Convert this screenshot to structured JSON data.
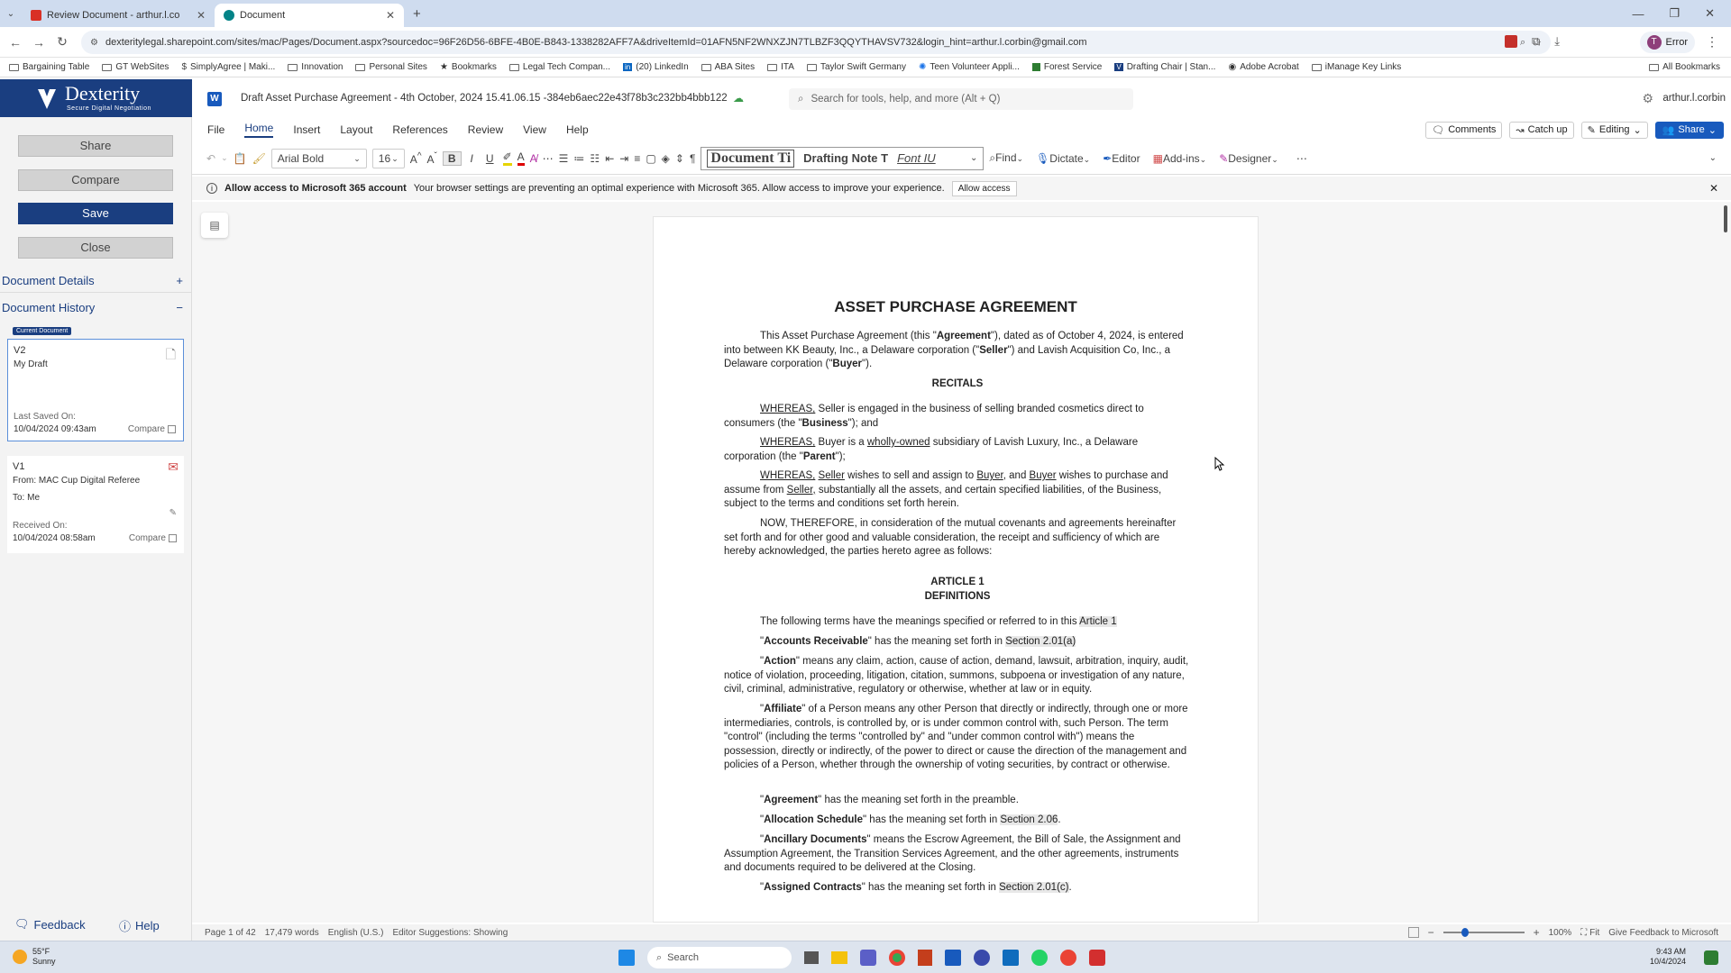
{
  "browser": {
    "tabs": [
      {
        "title": "Review Document - arthur.l.co"
      },
      {
        "title": "Document"
      }
    ],
    "new_tab": "+",
    "url": "dexteritylegal.sharepoint.com/sites/mac/Pages/Document.aspx?sourcedoc=96F26D56-6BFE-4B0E-B843-1338282AFF7A&driveItemId=01AFN5NF2WNXZJN7TLBZF3QQYTHAVSV732&login_hint=arthur.l.corbin@gmail.com",
    "profile_label": "Error",
    "profile_initial": "T",
    "bookmarks": [
      "Bargaining Table",
      "GT WebSites",
      "SimplyAgree | Maki...",
      "Innovation",
      "Personal Sites",
      "Bookmarks",
      "Legal Tech Compan...",
      "(20) LinkedIn",
      "ABA Sites",
      "ITA",
      "Taylor Swift Germany",
      "Teen Volunteer Appli...",
      "Forest Service",
      "Drafting Chair | Stan...",
      "Adobe Acrobat",
      "iManage Key Links"
    ],
    "all_bookmarks": "All Bookmarks"
  },
  "left_panel": {
    "logo_title": "Dexterity",
    "logo_subtitle": "Secure Digital Negotiation",
    "buttons": {
      "share": "Share",
      "compare": "Compare",
      "save": "Save",
      "close": "Close"
    },
    "document_details": "Document Details",
    "document_details_toggle": "+",
    "document_history": "Document History",
    "document_history_toggle": "−",
    "current_badge": "Current Document",
    "v2": {
      "version": "V2",
      "name": "My Draft",
      "saved_label": "Last Saved On:",
      "saved_date": "10/04/2024 09:43am",
      "compare": "Compare"
    },
    "v1": {
      "version": "V1",
      "from": "From: MAC Cup Digital Referee",
      "to": "To: Me",
      "received_label": "Received On:",
      "received_date": "10/04/2024 08:58am",
      "compare": "Compare"
    },
    "feedback": "Feedback",
    "help": "Help"
  },
  "word": {
    "doc_title": "Draft Asset Purchase Agreement - 4th October, 2024 15.41.06.15 -384eb6aec22e43f78b3c232bb4bbb122",
    "search_placeholder": "Search for tools, help, and more (Alt + Q)",
    "user": "arthur.l.corbin",
    "ribbon_tabs": [
      "File",
      "Home",
      "Insert",
      "Layout",
      "References",
      "Review",
      "View",
      "Help"
    ],
    "right_actions": {
      "comments": "Comments",
      "catchup": "Catch up",
      "editing": "Editing",
      "share": "Share"
    },
    "font_name": "Arial Bold",
    "font_size": "16",
    "styles": [
      "Document Ti",
      "Drafting Note T",
      "Font IU"
    ],
    "tools": {
      "find": "Find",
      "dictate": "Dictate",
      "editor": "Editor",
      "addins": "Add-ins",
      "designer": "Designer"
    },
    "infobar": {
      "title": "Allow access to Microsoft 365 account",
      "message": "Your browser settings are preventing an optimal experience with Microsoft 365. Allow access to improve your experience.",
      "button": "Allow access"
    }
  },
  "document": {
    "title": "ASSET PURCHASE AGREEMENT",
    "intro_a": "This Asset Purchase Agreement (this \"",
    "intro_b": "Agreement",
    "intro_c": "\"), dated as of October 4, 2024, is entered into between KK Beauty, Inc., a Delaware corporation (\"",
    "intro_d": "Seller",
    "intro_e": "\") and Lavish Acquisition Co, Inc., a Delaware corporation (\"",
    "intro_f": "Buyer",
    "intro_g": "\").",
    "recitals": "RECITALS",
    "w1_a": "WHEREAS,",
    "w1_b": " Seller is engaged in the business of selling branded cosmetics direct to consumers (the \"",
    "w1_c": "Business",
    "w1_d": "\"); and",
    "w2_a": "WHEREAS,",
    "w2_b": " Buyer is a ",
    "w2_c": "wholly-owned",
    "w2_d": " subsidiary of Lavish Luxury, Inc., a Delaware corporation (the \"",
    "w2_e": "Parent",
    "w2_f": "\");",
    "w3_a": "WHEREAS,",
    "w3_b": "Seller",
    "w3_c": " wishes to sell and assign to ",
    "w3_d": "Buyer",
    "w3_e": ", and ",
    "w3_f": "Buyer",
    "w3_g": " wishes to purchase and assume from ",
    "w3_h": "Seller,",
    "w3_i": " substantially all the assets, and certain specified liabilities, of the Business, subject to the terms and conditions set forth herein.",
    "now": "NOW, THEREFORE, in consideration of the mutual covenants and agreements hereinafter set forth and for other good and valuable consideration, the receipt and sufficiency of which are hereby acknowledged, the parties hereto agree as follows:",
    "article": "ARTICLE 1",
    "definitions": "DEFINITIONS",
    "def_intro_a": "The following terms have the meanings specified or referred to in this ",
    "def_intro_b": "Article 1",
    "d1_term": "Accounts Receivable",
    "d1_text": "\" has the meaning set forth in ",
    "d1_ref": "Section 2.01(a)",
    "d2_term": "Action",
    "d2_text": "\" means any claim, action, cause of action, demand, lawsuit, arbitration, inquiry, audit, notice of violation, proceeding, litigation, citation, summons, subpoena or investigation of any nature, civil, criminal, administrative, regulatory or otherwise, whether at law or in equity.",
    "d3_term": "Affiliate",
    "d3_text": "\" of a Person means any other Person that directly or indirectly, through one or more intermediaries, controls, is controlled by, or is under common control with, such Person. The term \"control\" (including the terms \"controlled by\" and \"under common control with\") means the possession, directly or indirectly, of the power to direct or cause the direction of the management and policies of a Person, whether through the ownership of voting securities, by contract or otherwise.",
    "d4_term": "Agreement",
    "d4_text": "\" has the meaning set forth in the preamble.",
    "d5_term": "Allocation Schedule",
    "d5_text": "\" has the meaning set forth in ",
    "d5_ref": "Section 2.06",
    "d6_term": "Ancillary Documents",
    "d6_text": "\" means the Escrow Agreement, the Bill of Sale, the Assignment and Assumption Agreement, the Transition Services Agreement, and the other agreements, instruments and documents required to be delivered at the Closing.",
    "d7_term": "Assigned Contracts",
    "d7_text": "\" has the meaning set forth in ",
    "d7_ref": "Section 2.01(c)"
  },
  "status": {
    "page": "Page 1 of 42",
    "words": "17,479 words",
    "language": "English (U.S.)",
    "editor": "Editor Suggestions: Showing",
    "zoom": "100%",
    "fit": "Fit",
    "feedback": "Give Feedback to Microsoft"
  },
  "taskbar": {
    "weather_temp": "55°F",
    "weather_desc": "Sunny",
    "search": "Search",
    "time": "9:43 AM",
    "date": "10/4/2024"
  },
  "colors": {
    "brand": "#1a3e80",
    "word_blue": "#185abd",
    "tab_strip": "#cfdcef"
  }
}
